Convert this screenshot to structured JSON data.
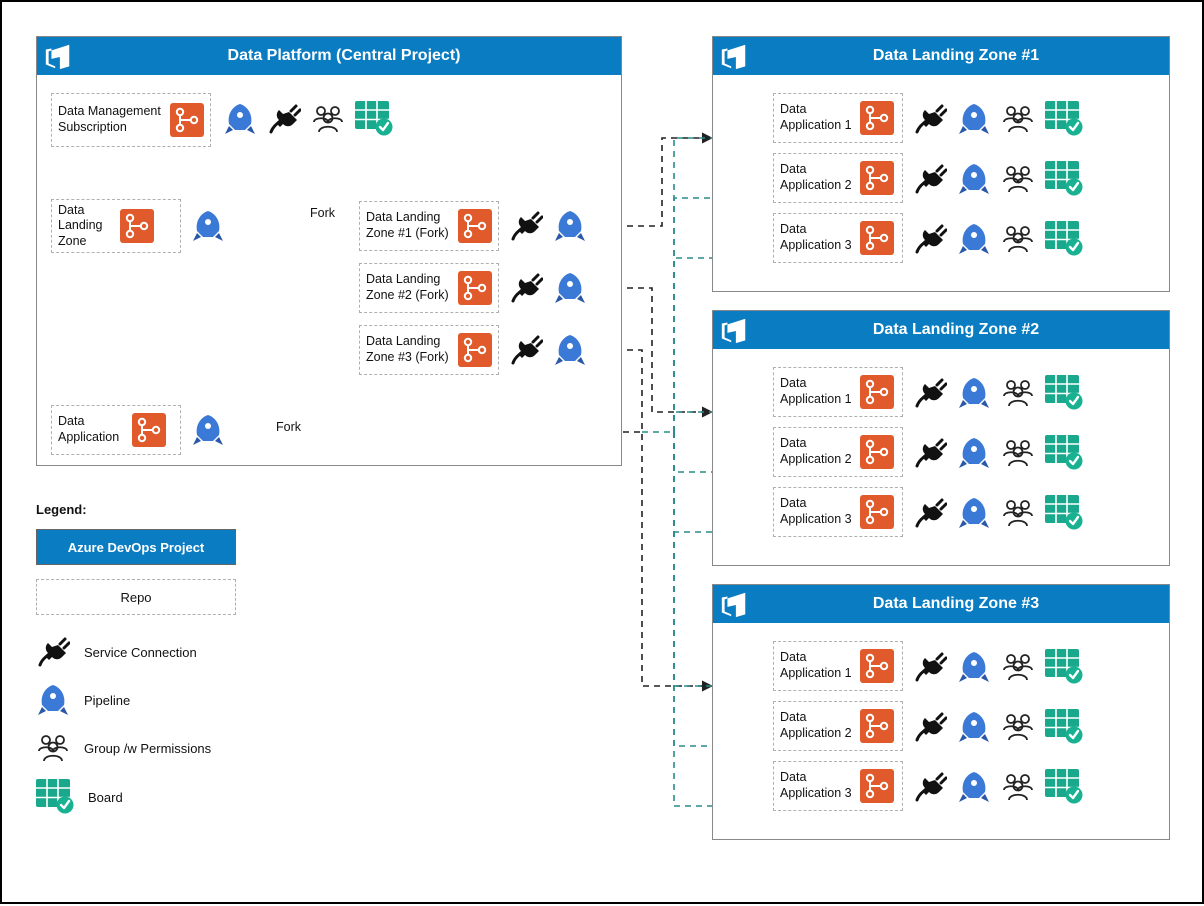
{
  "central": {
    "title": "Data Platform (Central Project)",
    "repos": {
      "mgmt": "Data Management Subscription",
      "dlz": "Data Landing Zone",
      "app": "Data Application",
      "fork1": "Data Landing Zone #1 (Fork)",
      "fork2": "Data Landing Zone #2 (Fork)",
      "fork3": "Data Landing Zone #3 (Fork)"
    }
  },
  "zones": [
    {
      "title": "Data Landing Zone #1",
      "apps": [
        "Data Application 1",
        "Data Application 2",
        "Data Application 3"
      ]
    },
    {
      "title": "Data Landing Zone #2",
      "apps": [
        "Data Application 1",
        "Data Application 2",
        "Data Application 3"
      ]
    },
    {
      "title": "Data Landing Zone #3",
      "apps": [
        "Data Application 1",
        "Data Application 2",
        "Data Application 3"
      ]
    }
  ],
  "fork_label": "Fork",
  "legend": {
    "heading": "Legend:",
    "project": "Azure DevOps Project",
    "repo": "Repo",
    "service": "Service Connection",
    "pipeline": "Pipeline",
    "group": "Group /w Permissions",
    "board": "Board"
  },
  "colors": {
    "header": "#0a7cc2",
    "repo_icon": "#e05a2b",
    "pipeline_icon": "#3b79d6",
    "board_icon": "#19a88c"
  }
}
